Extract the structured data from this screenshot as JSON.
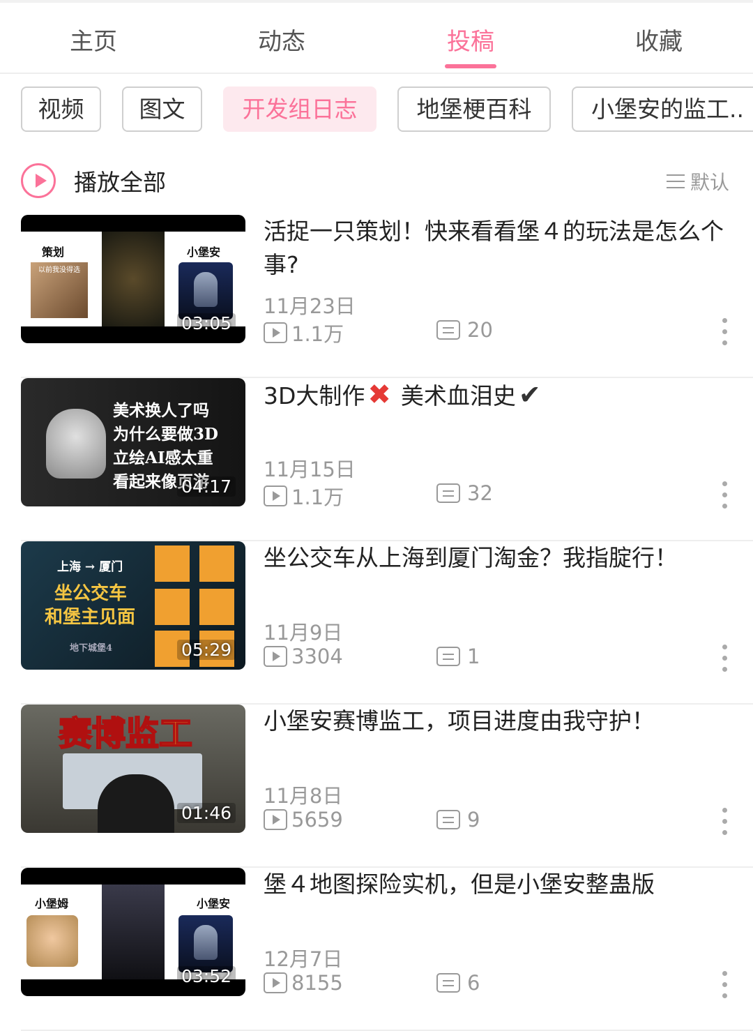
{
  "tabs": [
    {
      "label": "主页"
    },
    {
      "label": "动态"
    },
    {
      "label": "投稿"
    },
    {
      "label": "收藏"
    }
  ],
  "active_tab": "投稿",
  "accent_color": "#fb7299",
  "chips": [
    {
      "label": "视频"
    },
    {
      "label": "图文"
    },
    {
      "label": "开发组日志"
    },
    {
      "label": "地堡梗百科"
    },
    {
      "label": "小堡安的监工.."
    }
  ],
  "active_chip": "开发组日志",
  "play_all": {
    "label": "播放全部",
    "icon": "play-circle-icon"
  },
  "sort": {
    "label": "默认",
    "icon": "sort-lines-icon"
  },
  "videos": [
    {
      "title": "活捉一只策划！快来看看堡４的玩法是怎么个事?",
      "date": "11月23日",
      "views": "1.1万",
      "comments": "20",
      "duration": "03:05",
      "thumb_text": {
        "left": "策划",
        "left_sub": "以前我没得选",
        "right": "小堡安"
      }
    },
    {
      "title": "3D大制作",
      "title_tail": "美术血泪史",
      "date": "11月15日",
      "views": "1.1万",
      "comments": "32",
      "duration": "04:17",
      "thumb_text": {
        "line1": "美术换人了吗",
        "line2": "为什么要做3D",
        "line3": "立绘AI感太重",
        "line4": "看起来像页游"
      }
    },
    {
      "title": "坐公交车从上海到厦门淘金？我指腚行！",
      "date": "11月9日",
      "views": "3304",
      "comments": "1",
      "duration": "05:29",
      "thumb_text": {
        "route": "上海 → 厦门",
        "line1": "坐公交车",
        "line2": "和堡主见面",
        "logo": "地下城堡4"
      }
    },
    {
      "title": "小堡安赛博监工，项目进度由我守护！",
      "date": "11月8日",
      "views": "5659",
      "comments": "9",
      "duration": "01:46",
      "thumb_text": {
        "banner": "赛博监工"
      }
    },
    {
      "title": "堡４地图探险实机，但是小堡安整蛊版",
      "date": "12月7日",
      "views": "8155",
      "comments": "6",
      "duration": "03:52",
      "thumb_text": {
        "left": "小堡姆",
        "right": "小堡安"
      }
    }
  ]
}
